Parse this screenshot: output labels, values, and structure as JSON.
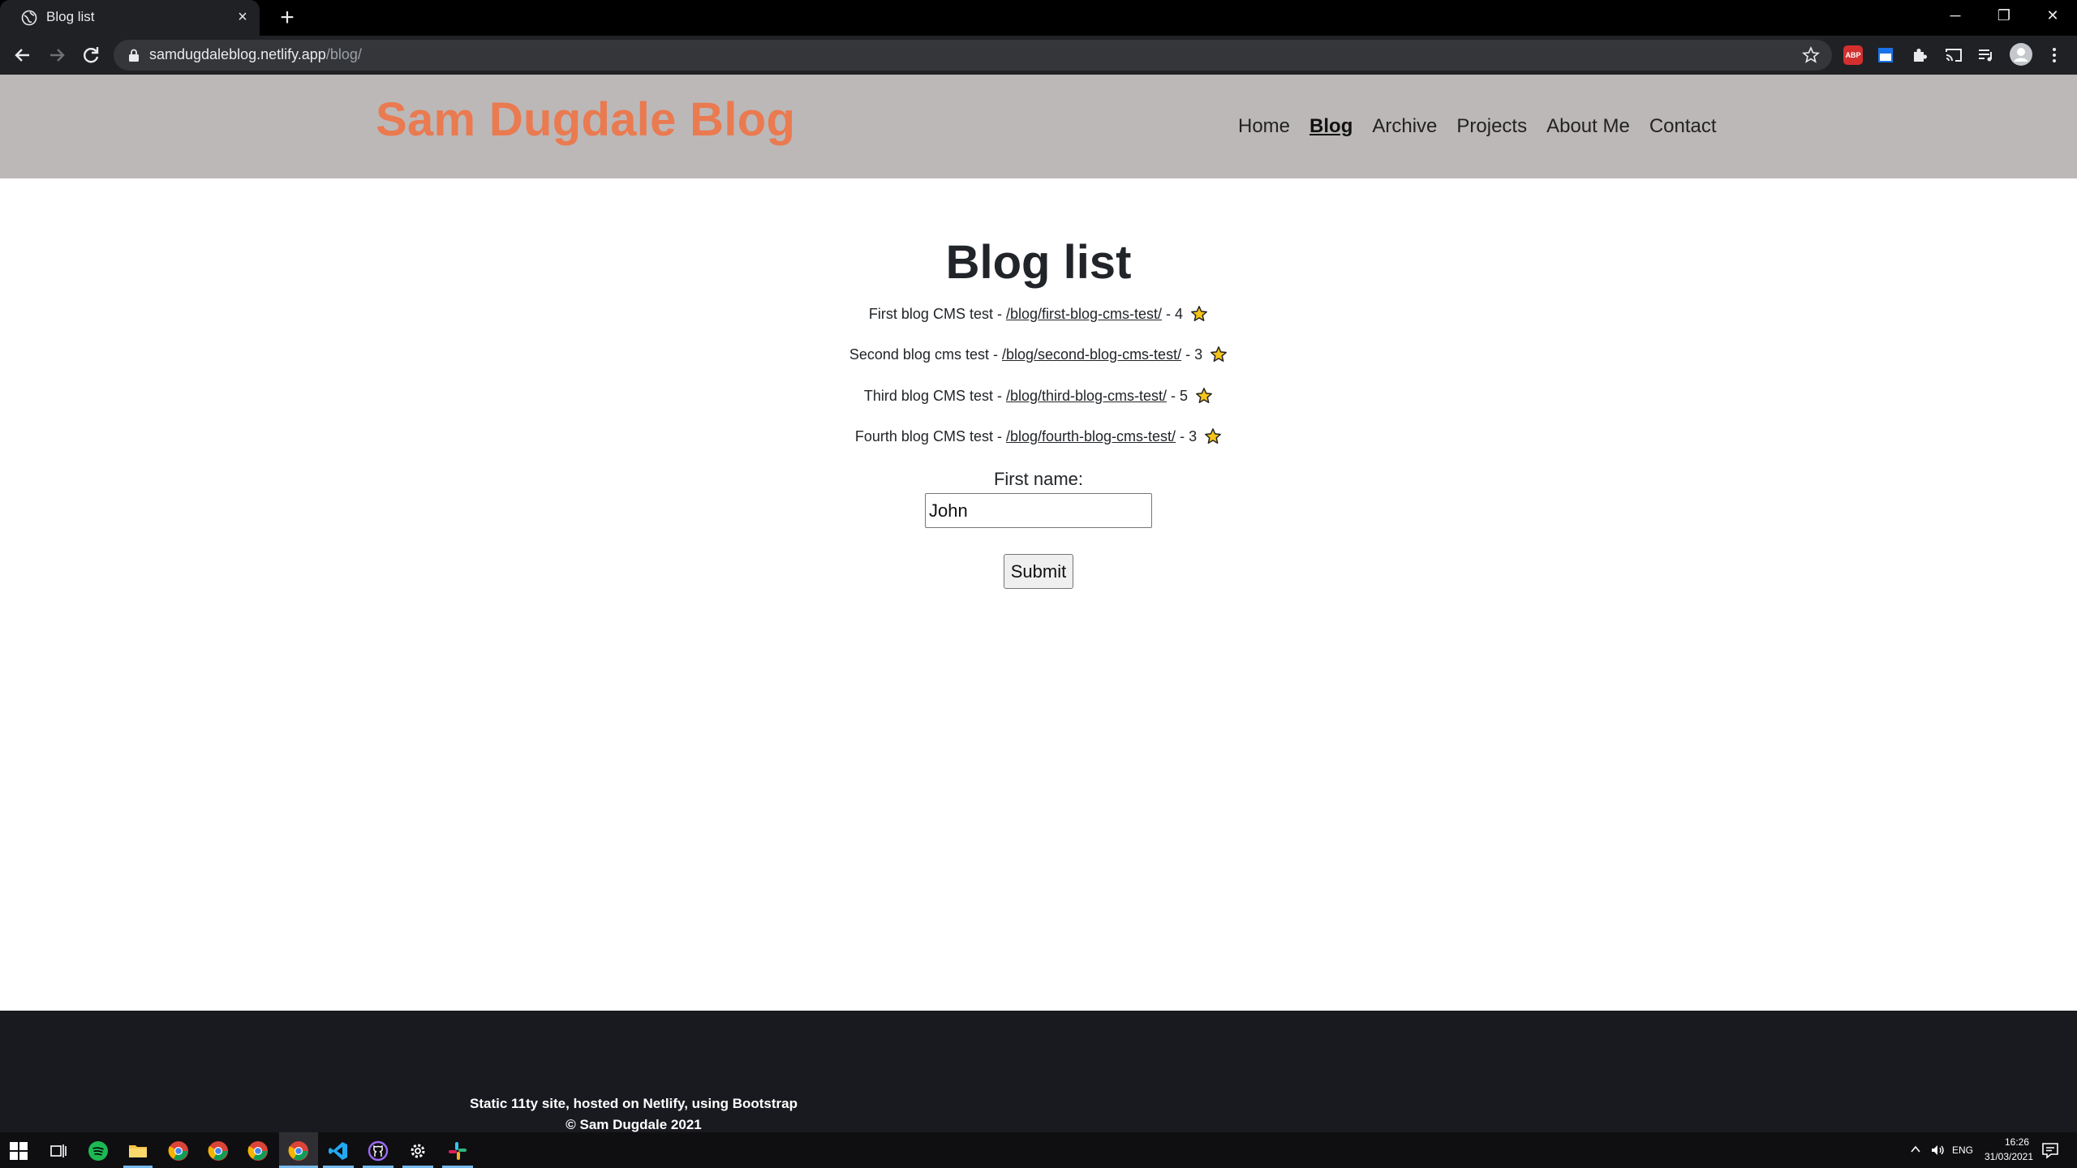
{
  "browser": {
    "tab": {
      "title": "Blog list",
      "favicon": "globe-icon",
      "close": "×"
    },
    "new_tab": "+",
    "window_controls": {
      "minimize": "─",
      "maximize": "❐",
      "close": "✕"
    },
    "address": {
      "host": "samdugdaleblog.netlify.app",
      "path": "/blog/"
    },
    "extensions": {
      "abp_label": "ABP"
    }
  },
  "site": {
    "brand": "Sam Dugdale Blog",
    "nav": [
      {
        "label": "Home",
        "active": false
      },
      {
        "label": "Blog",
        "active": true
      },
      {
        "label": "Archive",
        "active": false
      },
      {
        "label": "Projects",
        "active": false
      },
      {
        "label": "About Me",
        "active": false
      },
      {
        "label": "Contact",
        "active": false
      }
    ]
  },
  "main": {
    "title": "Blog list",
    "posts": [
      {
        "title": "First blog CMS test",
        "sep1": " - ",
        "link": "/blog/first-blog-cms-test/",
        "sep2": " - ",
        "rating": "4"
      },
      {
        "title": "Second blog cms test",
        "sep1": " - ",
        "link": "/blog/second-blog-cms-test/",
        "sep2": " - ",
        "rating": "3"
      },
      {
        "title": "Third blog CMS test",
        "sep1": " - ",
        "link": "/blog/third-blog-cms-test/",
        "sep2": " - ",
        "rating": "5"
      },
      {
        "title": "Fourth blog CMS test",
        "sep1": " - ",
        "link": "/blog/fourth-blog-cms-test/",
        "sep2": " - ",
        "rating": "3"
      }
    ],
    "form": {
      "label": "First name:",
      "value": "John",
      "submit": "Submit"
    }
  },
  "footer": {
    "line1": "Static 11ty site, hosted on Netlify, using Bootstrap",
    "line2": "© Sam Dugdale 2021"
  },
  "taskbar": {
    "language": "ENG",
    "time": "16:26",
    "date": "31/03/2021"
  },
  "colors": {
    "brand": "#ea7a50",
    "header_bg": "#bcb8b8",
    "footer_bg": "#191a20",
    "star": "#f5c518"
  }
}
